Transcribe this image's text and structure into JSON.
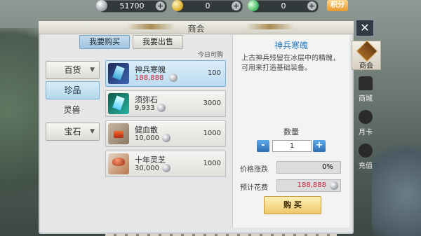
{
  "currency": {
    "silver": {
      "value": "51700",
      "icon": "silver-coin-icon"
    },
    "gold": {
      "value": "0",
      "icon": "gold-coin-icon"
    },
    "jade": {
      "value": "0",
      "icon": "jade-ingot-icon"
    },
    "score_label": "积分"
  },
  "window": {
    "title": "商会",
    "close_label": "✕"
  },
  "tabs": [
    {
      "label": "我要购买",
      "active": true
    },
    {
      "label": "我要出售",
      "active": false
    }
  ],
  "today_buy_label": "今日可购",
  "categories": [
    {
      "label": "百货",
      "has_dropdown": true
    },
    {
      "label": "珍品",
      "selected": true
    },
    {
      "label": "灵兽"
    },
    {
      "label": "宝石",
      "has_dropdown": true
    }
  ],
  "items": [
    {
      "name": "神兵寒魄",
      "price": "188,888",
      "quantity": "100",
      "icon": "cold-spirit-crystal-icon",
      "selected": true
    },
    {
      "name": "须弥石",
      "price": "9,933",
      "quantity": "3000",
      "icon": "xumi-stone-icon"
    },
    {
      "name": "健血散",
      "price": "10,000",
      "quantity": "1000",
      "icon": "blood-powder-icon"
    },
    {
      "name": "十年灵芝",
      "price": "30,000",
      "quantity": "1000",
      "icon": "lingzhi-mushroom-icon"
    }
  ],
  "detail": {
    "name": "神兵寒魄",
    "description": "上古神兵残留在冰层中的精魄，可用来打造基础装备。",
    "quantity_label": "数量",
    "quantity_value": "1",
    "minus_label": "-",
    "plus_label": "+",
    "price_change_label": "价格涨跌",
    "price_change_value": "0%",
    "estimated_cost_label": "预计花费",
    "estimated_cost_value": "188,888",
    "buy_label": "购 买"
  },
  "side_nav": [
    {
      "label": "商会",
      "icon": "chamber-of-commerce-icon",
      "active": true
    },
    {
      "label": "商城",
      "icon": "mall-icon"
    },
    {
      "label": "月卡",
      "icon": "monthly-card-icon"
    },
    {
      "label": "充值",
      "icon": "recharge-icon"
    }
  ]
}
